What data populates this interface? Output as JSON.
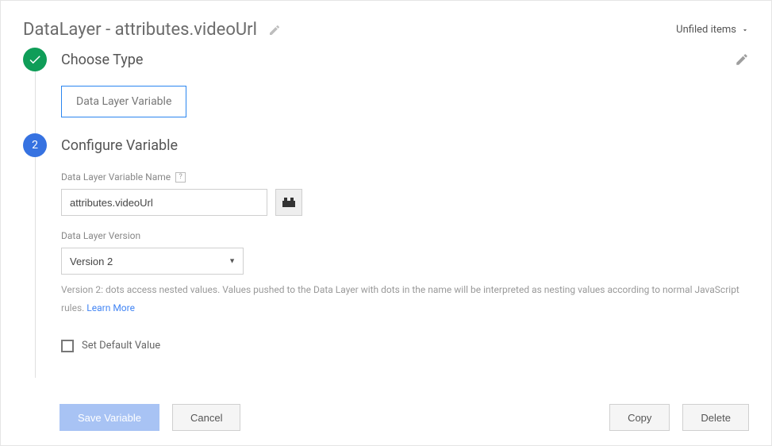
{
  "header": {
    "title": "DataLayer - attributes.videoUrl",
    "unfiled_label": "Unfiled items"
  },
  "step1": {
    "title": "Choose Type",
    "type_chip": "Data Layer Variable"
  },
  "step2": {
    "number": "2",
    "title": "Configure Variable",
    "var_name_label": "Data Layer Variable Name",
    "var_name_value": "attributes.videoUrl",
    "version_label": "Data Layer Version",
    "version_value": "Version 2",
    "help_text": "Version 2: dots access nested values. Values pushed to the Data Layer with dots in the name will be interpreted as nesting values according to normal JavaScript rules. ",
    "learn_more": "Learn More",
    "default_checkbox_label": "Set Default Value"
  },
  "footer": {
    "save": "Save Variable",
    "cancel": "Cancel",
    "copy": "Copy",
    "delete": "Delete"
  }
}
